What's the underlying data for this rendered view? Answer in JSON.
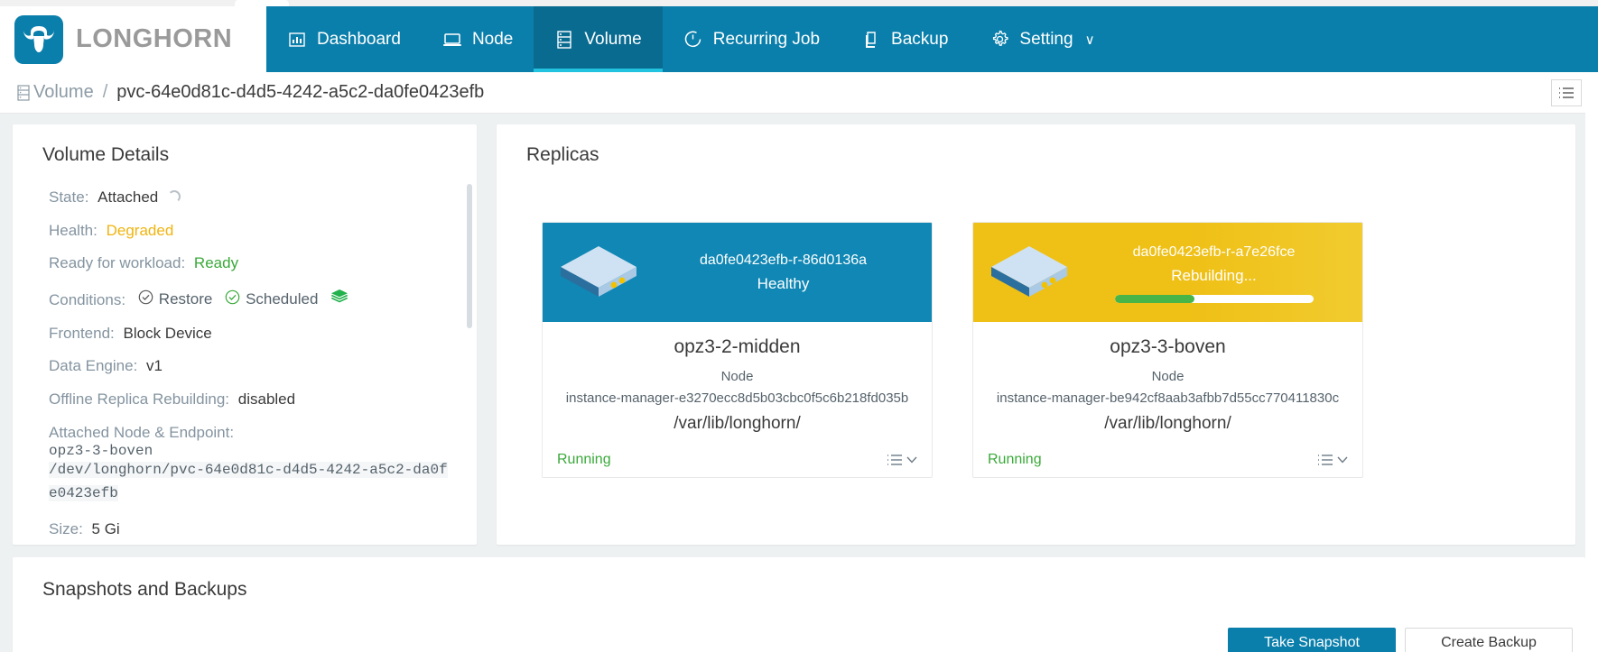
{
  "brand": {
    "name": "LONGHORN",
    "logo_icon": "longhorn-bull-logo",
    "accent": "#0b7fab"
  },
  "nav": {
    "items": [
      {
        "label": "Dashboard",
        "icon": "chart-bar-icon",
        "active": false
      },
      {
        "label": "Node",
        "icon": "server-node-icon",
        "active": false
      },
      {
        "label": "Volume",
        "icon": "database-stack-icon",
        "active": true
      },
      {
        "label": "Recurring Job",
        "icon": "clock-icon",
        "active": false
      },
      {
        "label": "Backup",
        "icon": "copy-icon",
        "active": false
      },
      {
        "label": "Setting",
        "icon": "gear-icon",
        "active": false,
        "chevron": "∨"
      }
    ]
  },
  "breadcrumb": {
    "icon": "volume-icon",
    "root": "Volume",
    "separator": "/",
    "current": "pvc-64e0d81c-d4d5-4242-a5c2-da0fe0423efb",
    "list_icon": "list-icon"
  },
  "details": {
    "title": "Volume Details",
    "rows": [
      {
        "label": "State:",
        "value": "Attached",
        "tone": "plain",
        "spinner": true
      },
      {
        "label": "Health:",
        "value": "Degraded",
        "tone": "warn"
      },
      {
        "label": "Ready for workload:",
        "value": "Ready",
        "tone": "ok"
      },
      {
        "label": "Frontend:",
        "value": "Block Device",
        "tone": "plain"
      },
      {
        "label": "Data Engine:",
        "value": "v1",
        "tone": "plain"
      },
      {
        "label": "Offline Replica Rebuilding:",
        "value": "disabled",
        "tone": "plain"
      },
      {
        "label": "Size:",
        "value": "5 Gi",
        "tone": "plain"
      }
    ],
    "conditions_label": "Conditions:",
    "conditions": [
      {
        "label": "Restore",
        "state": "neutral",
        "icon": "check-circle-icon"
      },
      {
        "label": "Scheduled",
        "state": "ok",
        "icon": "check-circle-icon"
      }
    ],
    "conditions_extra_icon": "layers-icon",
    "endpoint_label": "Attached Node & Endpoint:",
    "endpoint_node": "opz3-3-boven",
    "endpoint_path": "/dev/longhorn/pvc-64e0d81c-d4d5-4242-a5c2-da0fe0423efb"
  },
  "replicas": {
    "title": "Replicas",
    "items": [
      {
        "name": "da0fe0423efb-r-86d0136a",
        "status": "Healthy",
        "status_kind": "healthy",
        "node": "opz3-2-midden",
        "node_label": "Node",
        "instance_manager": "instance-manager-e3270ecc8d5b03cbc0f5c6b218fd035b",
        "path": "/var/lib/longhorn/",
        "running": "Running",
        "menu_icon": "list-chevron-icon",
        "disk_icon": "disk-3d-icon",
        "progress": null
      },
      {
        "name": "da0fe0423efb-r-a7e26fce",
        "status": "Rebuilding...",
        "status_kind": "rebuilding",
        "node": "opz3-3-boven",
        "node_label": "Node",
        "instance_manager": "instance-manager-be942cf8aab3afbb7d55cc770411830c",
        "path": "/var/lib/longhorn/",
        "running": "Running",
        "menu_icon": "list-chevron-icon",
        "disk_icon": "disk-3d-icon",
        "progress": 40
      }
    ]
  },
  "bottom": {
    "title": "Snapshots and Backups",
    "primary_button": "Take Snapshot",
    "secondary_button": "Create Backup"
  },
  "colors": {
    "brand_blue": "#0b7fab",
    "active_blue": "#0a6b91",
    "accent_cyan": "#21c3e0",
    "healthy_blue": "#1087b4",
    "rebuilding_yellow": "#efc016",
    "ok_green": "#3aa93a",
    "warn_yellow": "#f0b40f",
    "progress_green": "#49b549"
  }
}
